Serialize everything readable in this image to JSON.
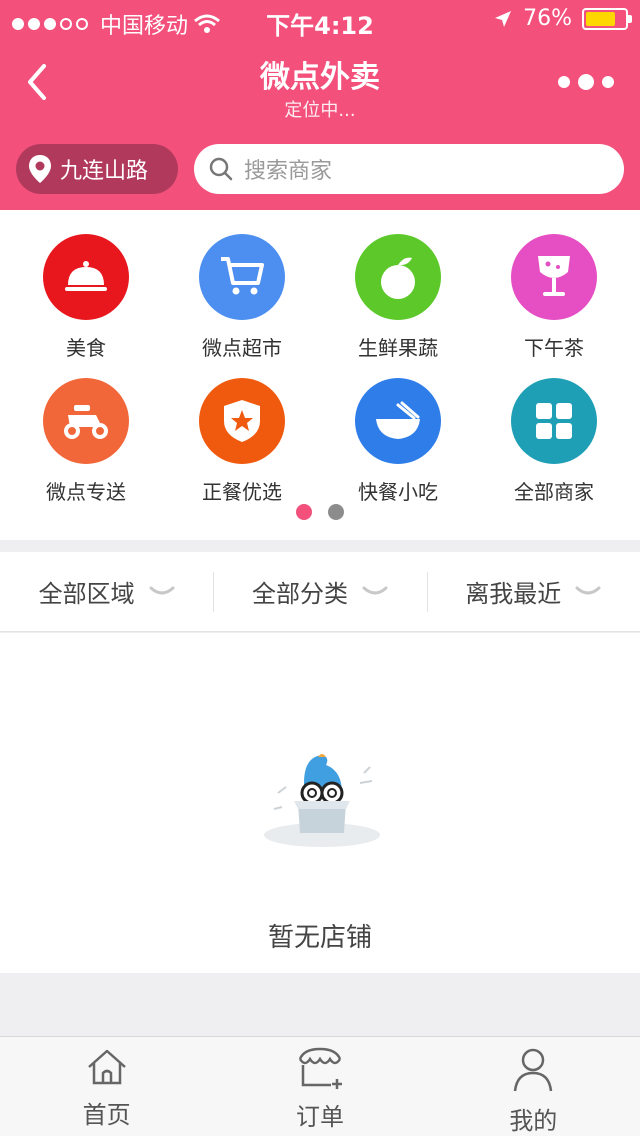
{
  "status_bar": {
    "carrier": "中国移动",
    "time": "下午4:12",
    "battery": "76%",
    "battery_level": 0.76
  },
  "header": {
    "title": "微点外卖",
    "subtitle": "定位中..."
  },
  "location": {
    "label": "九连山路"
  },
  "search": {
    "placeholder": "搜索商家"
  },
  "categories": [
    {
      "label": "美食",
      "icon": "food-cloche-icon",
      "color": "#e8171d"
    },
    {
      "label": "微点超市",
      "icon": "shopping-cart-icon",
      "color": "#4c8ff0"
    },
    {
      "label": "生鲜果蔬",
      "icon": "apple-icon",
      "color": "#5cc82a"
    },
    {
      "label": "下午茶",
      "icon": "drink-glass-icon",
      "color": "#e54fc3"
    },
    {
      "label": "微点专送",
      "icon": "scooter-icon",
      "color": "#f2673a"
    },
    {
      "label": "正餐优选",
      "icon": "star-shield-icon",
      "color": "#f05a0f"
    },
    {
      "label": "快餐小吃",
      "icon": "noodle-bowl-icon",
      "color": "#2f7de8"
    },
    {
      "label": "全部商家",
      "icon": "grid-icon",
      "color": "#1f9fb5"
    }
  ],
  "pager": {
    "pages": 2,
    "current": 1
  },
  "filters": [
    {
      "label": "全部区域"
    },
    {
      "label": "全部分类"
    },
    {
      "label": "离我最近"
    }
  ],
  "empty_state": {
    "text": "暂无店铺"
  },
  "tabbar": [
    {
      "label": "首页",
      "icon": "home-icon"
    },
    {
      "label": "订单",
      "icon": "shop-awning-icon"
    },
    {
      "label": "我的",
      "icon": "user-icon"
    }
  ],
  "colors": {
    "brand": "#f3507c",
    "location_pill": "#b13a5c"
  }
}
